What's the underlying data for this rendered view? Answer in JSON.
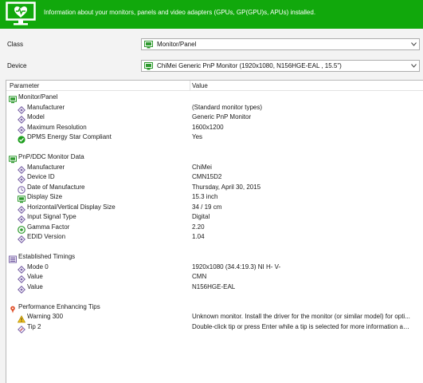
{
  "header": {
    "description": "Information about your monitors, panels and video adapters (GPUs, GP(GPU)s, APUs) installed."
  },
  "fields": {
    "class_label": "Class",
    "class_value": "Monitor/Panel",
    "device_label": "Device",
    "device_value": "ChiMei Generic PnP Monitor (1920x1080, N156HGE-EAL , 15.5\")"
  },
  "table": {
    "col_parameter": "Parameter",
    "col_value": "Value",
    "groups": [
      {
        "title": "Monitor/Panel",
        "icon": "monitor-icon",
        "rows": [
          {
            "param": "Manufacturer",
            "value": "(Standard monitor types)",
            "icon": "diamond-icon"
          },
          {
            "param": "Model",
            "value": "Generic PnP Monitor",
            "icon": "diamond-icon"
          },
          {
            "param": "Maximum Resolution",
            "value": "1600x1200",
            "icon": "diamond-icon"
          },
          {
            "param": "DPMS Energy Star Compliant",
            "value": "Yes",
            "icon": "check-icon"
          }
        ]
      },
      {
        "title": "PnP/DDC Monitor Data",
        "icon": "monitor-icon",
        "rows": [
          {
            "param": "Manufacturer",
            "value": "ChiMei",
            "icon": "diamond-icon"
          },
          {
            "param": "Device ID",
            "value": "CMN15D2",
            "icon": "diamond-icon"
          },
          {
            "param": "Date of Manufacture",
            "value": "Thursday, April 30, 2015",
            "icon": "clock-icon"
          },
          {
            "param": "Display Size",
            "value": "15.3 inch",
            "icon": "monitor-icon"
          },
          {
            "param": "Horizontal/Vertical Display Size",
            "value": "34 / 19 cm",
            "icon": "diamond-icon"
          },
          {
            "param": "Input Signal Type",
            "value": "Digital",
            "icon": "diamond-icon"
          },
          {
            "param": "Gamma Factor",
            "value": "2.20",
            "icon": "gamma-icon"
          },
          {
            "param": "EDID Version",
            "value": "1.04",
            "icon": "diamond-icon"
          }
        ]
      },
      {
        "title": "Established Timings",
        "icon": "list-icon",
        "rows": [
          {
            "param": "Mode 0",
            "value": "1920x1080 (34.4:19.3) NI H- V-",
            "icon": "diamond-icon"
          },
          {
            "param": "Value",
            "value": "CMN",
            "icon": "diamond-icon"
          },
          {
            "param": "Value",
            "value": "N156HGE-EAL",
            "icon": "diamond-icon"
          }
        ]
      },
      {
        "title": "Performance Enhancing Tips",
        "icon": "pin-icon",
        "rows": [
          {
            "param": "Warning 300",
            "value": "Unknown monitor. Install the driver for the monitor (or similar model) for opti...",
            "icon": "warning-icon"
          },
          {
            "param": "Tip 2",
            "value": "Double-click tip or press Enter while a tip is selected for more information ab...",
            "icon": "tip-icon"
          }
        ]
      }
    ]
  },
  "colors": {
    "header_green": "#11a80c",
    "panel_bg": "#f3f3f3",
    "icon_purple": "#7b64a8",
    "icon_green": "#2e9a2e"
  }
}
